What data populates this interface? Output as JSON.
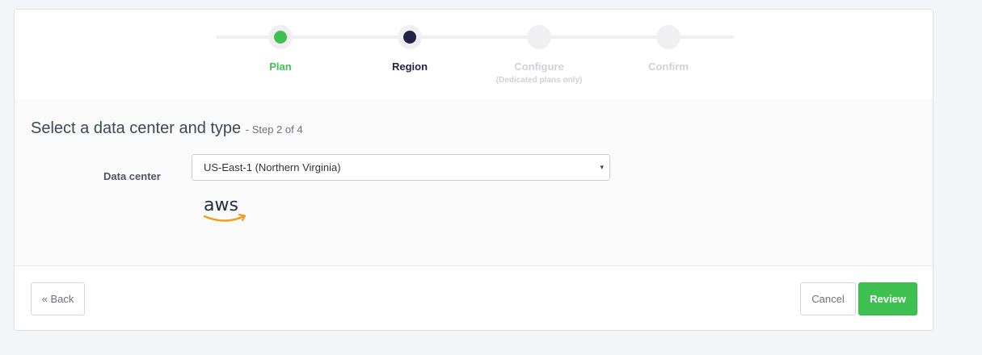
{
  "stepper": {
    "steps": [
      {
        "label": "Plan",
        "sublabel": "",
        "state": "completed",
        "dot_color": "#3fc152",
        "label_color": "#3fc152"
      },
      {
        "label": "Region",
        "sublabel": "",
        "state": "current",
        "dot_color": "#23234a",
        "label_color": "#23234a"
      },
      {
        "label": "Configure",
        "sublabel": "(Dedicated plans only)",
        "state": "upcoming",
        "dot_color": "#f0f0f2",
        "label_color": "#cfd1d6"
      },
      {
        "label": "Confirm",
        "sublabel": "",
        "state": "upcoming",
        "dot_color": "#f0f0f2",
        "label_color": "#cfd1d6"
      }
    ]
  },
  "section": {
    "title": "Select a data center and type",
    "step_indicator": "- Step 2 of 4"
  },
  "form": {
    "data_center_label": "Data center",
    "data_center_value": "US-East-1 (Northern Virginia)",
    "provider_logo_text": "aws",
    "provider_icon": "aws-logo",
    "arrow_icon": "▾"
  },
  "footer": {
    "back_label": "« Back",
    "cancel_label": "Cancel",
    "review_label": "Review"
  },
  "colors": {
    "accent_green": "#3fc152",
    "current_navy": "#23234a",
    "aws_orange": "#f29b1d",
    "aws_text": "#232f3e"
  }
}
